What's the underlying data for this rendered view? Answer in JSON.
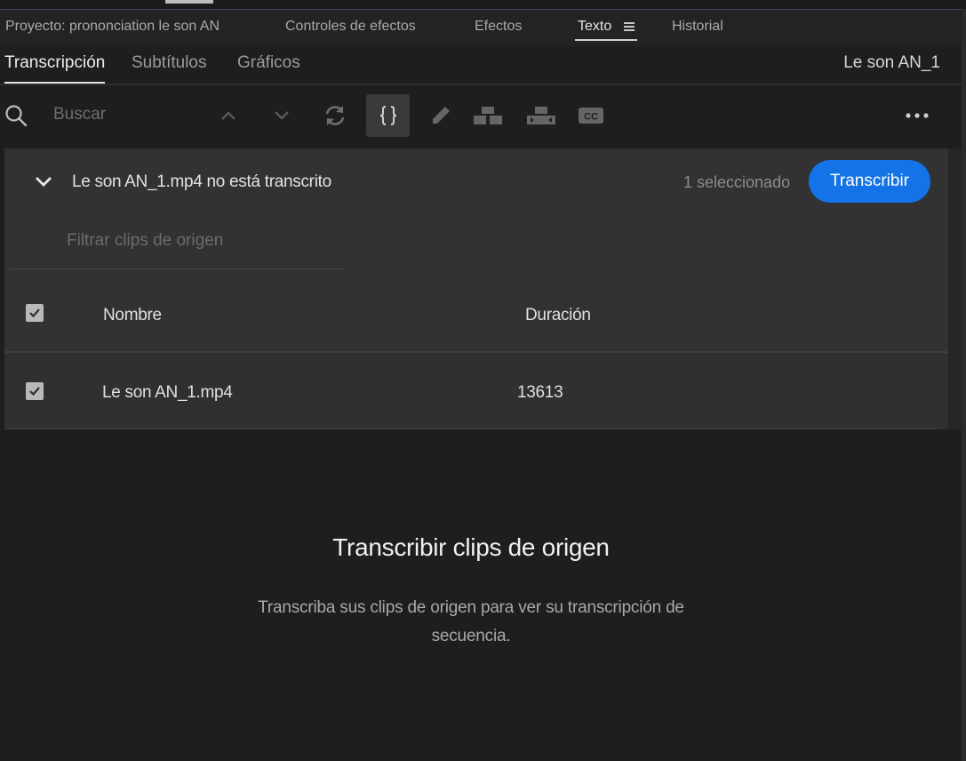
{
  "panel_tabs": [
    {
      "label": "Proyecto: prononciation le son AN"
    },
    {
      "label": "Controles de efectos"
    },
    {
      "label": "Efectos"
    },
    {
      "label": "Texto"
    },
    {
      "label": "Historial"
    }
  ],
  "sub_tabs": [
    {
      "label": "Transcripción"
    },
    {
      "label": "Subtítulos"
    },
    {
      "label": "Gráficos"
    }
  ],
  "sequence_name": "Le son AN_1",
  "toolbar": {
    "search_placeholder": "Buscar",
    "icons": [
      "search-icon",
      "chevron-up-icon",
      "chevron-down-icon",
      "refresh-icon",
      "braces-icon",
      "pencil-icon",
      "split-segment-icon",
      "merge-segment-icon",
      "captions-icon",
      "more-icon"
    ]
  },
  "transcribe_panel": {
    "title": "Le son AN_1.mp4 no está transcrito",
    "selected_count": "1 seleccionado",
    "transcribe_button": "Transcribir",
    "filter_placeholder": "Filtrar clips de origen",
    "columns": {
      "name": "Nombre",
      "duration": "Duración"
    },
    "rows": [
      {
        "name": "Le son AN_1.mp4",
        "duration": "13613",
        "checked": true
      }
    ]
  },
  "empty_state": {
    "title": "Transcribir clips de origen",
    "description": "Transcriba sus clips de origen para ver su transcripción de secuencia."
  },
  "colors": {
    "accent": "#1473e6",
    "background": "#1e1e1e",
    "panel": "#323232"
  }
}
